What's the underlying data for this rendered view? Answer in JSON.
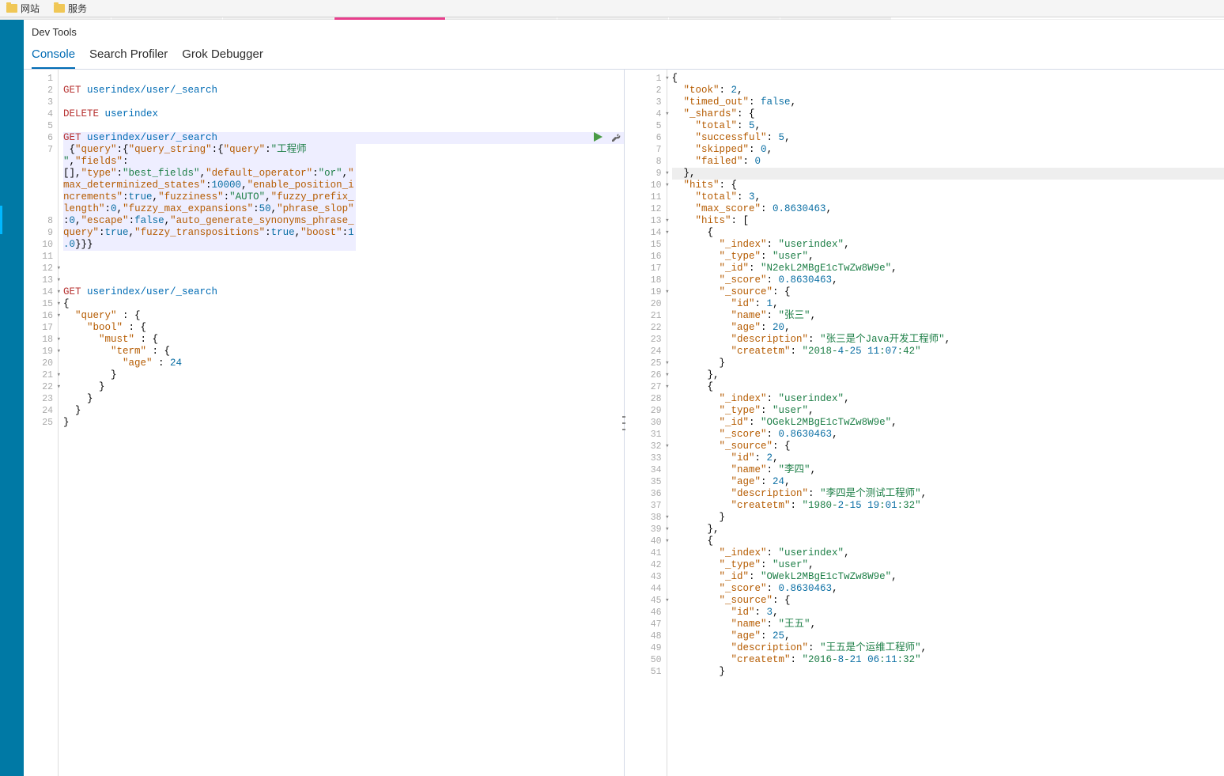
{
  "topbar": {
    "bookmarks": [
      "网站",
      "服务"
    ]
  },
  "page": {
    "title": "Dev Tools"
  },
  "tabs": {
    "items": [
      "Console",
      "Search Profiler",
      "Grok Debugger"
    ],
    "active": 0
  },
  "left_editor": {
    "lines": [
      {
        "n": 1,
        "t": "",
        "type": "blank"
      },
      {
        "n": 2,
        "t": "GET userindex/user/_search",
        "type": "req",
        "method": "GET",
        "path": "userindex/user/_search"
      },
      {
        "n": 3,
        "t": "",
        "type": "blank"
      },
      {
        "n": 4,
        "t": "DELETE   userindex",
        "type": "req",
        "method": "DELETE",
        "path": "userindex"
      },
      {
        "n": 5,
        "t": "",
        "type": "blank"
      },
      {
        "n": 6,
        "t": "GET userindex/user/_search",
        "type": "req",
        "method": "GET",
        "path": "userindex/user/_search",
        "active": true
      },
      {
        "n": 7,
        "t": " {\"query\":{\"query_string\":{\"query\":\"工程师 \",\"fields\":[],\"type\":\"best_fields\",\"default_operator\":\"or\",\"max_determinized_states\":10000,\"enable_position_increments\":true,\"fuzziness\":\"AUTO\",\"fuzzy_prefix_length\":0,\"fuzzy_max_expansions\":50,\"phrase_slop\":0,\"escape\":false,\"auto_generate_synonyms_phrase_query\":true,\"fuzzy_transpositions\":true,\"boost\":1.0}}}",
        "type": "json-inline",
        "active": true
      },
      {
        "n": 8,
        "t": "",
        "type": "blank"
      },
      {
        "n": 9,
        "t": "",
        "type": "blank"
      },
      {
        "n": 10,
        "t": "",
        "type": "blank"
      },
      {
        "n": 11,
        "t": "GET userindex/user/_search",
        "type": "req",
        "method": "GET",
        "path": "userindex/user/_search"
      },
      {
        "n": 12,
        "t": "{",
        "type": "json",
        "fold": true
      },
      {
        "n": 13,
        "t": "  \"query\" : {",
        "type": "json",
        "fold": true
      },
      {
        "n": 14,
        "t": "    \"bool\" : {",
        "type": "json",
        "fold": true
      },
      {
        "n": 15,
        "t": "      \"must\" : {",
        "type": "json",
        "fold": true
      },
      {
        "n": 16,
        "t": "        \"term\" : {",
        "type": "json",
        "fold": true
      },
      {
        "n": 17,
        "t": "          \"age\" : 24",
        "type": "json"
      },
      {
        "n": 18,
        "t": "        }",
        "type": "json",
        "fold": true
      },
      {
        "n": 19,
        "t": "      }",
        "type": "json",
        "fold": true
      },
      {
        "n": 20,
        "t": "    }",
        "type": "json"
      },
      {
        "n": 21,
        "t": "  }",
        "type": "json",
        "fold": true
      },
      {
        "n": 22,
        "t": "}",
        "type": "json",
        "fold": true
      },
      {
        "n": 23,
        "t": "",
        "type": "blank"
      },
      {
        "n": 24,
        "t": "",
        "type": "blank"
      },
      {
        "n": 25,
        "t": "",
        "type": "blank"
      }
    ]
  },
  "right_output": {
    "lines": [
      {
        "n": 1,
        "t": "{",
        "fold": true
      },
      {
        "n": 2,
        "t": "  \"took\": 2,"
      },
      {
        "n": 3,
        "t": "  \"timed_out\": false,"
      },
      {
        "n": 4,
        "t": "  \"_shards\": {",
        "fold": true
      },
      {
        "n": 5,
        "t": "    \"total\": 5,"
      },
      {
        "n": 6,
        "t": "    \"successful\": 5,"
      },
      {
        "n": 7,
        "t": "    \"skipped\": 0,"
      },
      {
        "n": 8,
        "t": "    \"failed\": 0"
      },
      {
        "n": 9,
        "t": "  },",
        "hl": true,
        "fold": true
      },
      {
        "n": 10,
        "t": "  \"hits\": {",
        "fold": true
      },
      {
        "n": 11,
        "t": "    \"total\": 3,"
      },
      {
        "n": 12,
        "t": "    \"max_score\": 0.8630463,"
      },
      {
        "n": 13,
        "t": "    \"hits\": [",
        "fold": true
      },
      {
        "n": 14,
        "t": "      {",
        "fold": true
      },
      {
        "n": 15,
        "t": "        \"_index\": \"userindex\","
      },
      {
        "n": 16,
        "t": "        \"_type\": \"user\","
      },
      {
        "n": 17,
        "t": "        \"_id\": \"N2ekL2MBgE1cTwZw8W9e\","
      },
      {
        "n": 18,
        "t": "        \"_score\": 0.8630463,"
      },
      {
        "n": 19,
        "t": "        \"_source\": {",
        "fold": true
      },
      {
        "n": 20,
        "t": "          \"id\": 1,"
      },
      {
        "n": 21,
        "t": "          \"name\": \"张三\","
      },
      {
        "n": 22,
        "t": "          \"age\": 20,"
      },
      {
        "n": 23,
        "t": "          \"description\": \"张三是个Java开发工程师\","
      },
      {
        "n": 24,
        "t": "          \"createtm\": \"2018-4-25 11:07:42\""
      },
      {
        "n": 25,
        "t": "        }",
        "fold": true
      },
      {
        "n": 26,
        "t": "      },",
        "fold": true
      },
      {
        "n": 27,
        "t": "      {",
        "fold": true
      },
      {
        "n": 28,
        "t": "        \"_index\": \"userindex\","
      },
      {
        "n": 29,
        "t": "        \"_type\": \"user\","
      },
      {
        "n": 30,
        "t": "        \"_id\": \"OGekL2MBgE1cTwZw8W9e\","
      },
      {
        "n": 31,
        "t": "        \"_score\": 0.8630463,"
      },
      {
        "n": 32,
        "t": "        \"_source\": {",
        "fold": true
      },
      {
        "n": 33,
        "t": "          \"id\": 2,"
      },
      {
        "n": 34,
        "t": "          \"name\": \"李四\","
      },
      {
        "n": 35,
        "t": "          \"age\": 24,"
      },
      {
        "n": 36,
        "t": "          \"description\": \"李四是个测试工程师\","
      },
      {
        "n": 37,
        "t": "          \"createtm\": \"1980-2-15 19:01:32\""
      },
      {
        "n": 38,
        "t": "        }",
        "fold": true
      },
      {
        "n": 39,
        "t": "      },",
        "fold": true
      },
      {
        "n": 40,
        "t": "      {",
        "fold": true
      },
      {
        "n": 41,
        "t": "        \"_index\": \"userindex\","
      },
      {
        "n": 42,
        "t": "        \"_type\": \"user\","
      },
      {
        "n": 43,
        "t": "        \"_id\": \"OWekL2MBgE1cTwZw8W9e\","
      },
      {
        "n": 44,
        "t": "        \"_score\": 0.8630463,"
      },
      {
        "n": 45,
        "t": "        \"_source\": {",
        "fold": true
      },
      {
        "n": 46,
        "t": "          \"id\": 3,"
      },
      {
        "n": 47,
        "t": "          \"name\": \"王五\","
      },
      {
        "n": 48,
        "t": "          \"age\": 25,"
      },
      {
        "n": 49,
        "t": "          \"description\": \"王五是个运维工程师\","
      },
      {
        "n": 50,
        "t": "          \"createtm\": \"2016-8-21 06:11:32\""
      },
      {
        "n": 51,
        "t": "        }"
      }
    ]
  }
}
